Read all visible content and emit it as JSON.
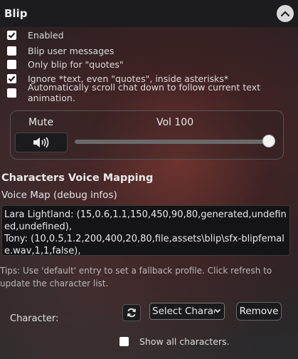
{
  "header": {
    "title": "Blip"
  },
  "options": [
    {
      "label": "Enabled",
      "checked": true
    },
    {
      "label": "Blip user messages",
      "checked": false
    },
    {
      "label": "Only blip for \"quotes\"",
      "checked": false
    },
    {
      "label": "Ignore *text, even \"quotes\", inside asterisks*",
      "checked": true
    },
    {
      "label": "Automatically scroll chat down to follow current text animation.",
      "checked": false
    }
  ],
  "volume": {
    "mute_label": "Mute",
    "vol_label": "Vol 100",
    "level_percent": 100,
    "icon": "speaker-icon"
  },
  "mapping": {
    "section_title": "Characters Voice Mapping",
    "voice_map_label": "Voice Map (debug infos)",
    "voice_map_text": "Lara Lightland: (15,0.6,1.1,150,450,90,80,generated,undefined,undefined),\nTony: (10,0.5,1.2,200,400,20,80,file,assets\\blip\\sfx-blipfemale.wav,1,1,false),",
    "tips": "Tips: Use 'default' entry to set a fallback profile. Click refresh to update the character list."
  },
  "character": {
    "label": "Character:",
    "select_value": "Select Character",
    "remove_label": "Remove",
    "show_all_label": "Show all characters.",
    "show_all_checked": false
  }
}
